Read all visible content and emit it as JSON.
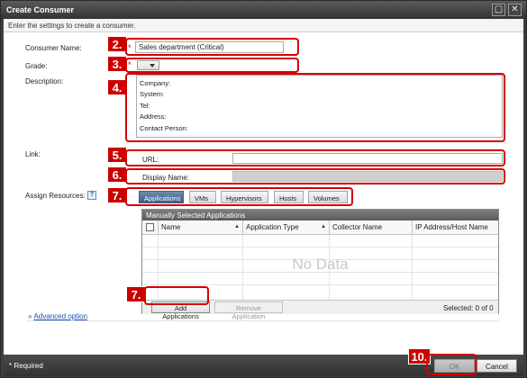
{
  "window": {
    "title": "Create Consumer",
    "maximize_icon": "maximize-icon",
    "close_icon": "close-icon"
  },
  "instructions": "Enter the settings to create a consumer.",
  "form": {
    "consumer_name": {
      "label": "Consumer Name:",
      "value": "Sales department (Critical)",
      "required": "*"
    },
    "grade": {
      "label": "Grade:",
      "required": "*",
      "value": ""
    },
    "description": {
      "label": "Description:",
      "lines": [
        "Company:",
        "System:",
        "Tel:",
        "Address:",
        "Contact Person:"
      ]
    },
    "link": {
      "label": "Link:",
      "url_label": "URL:",
      "url_value": "",
      "display_name_label": "Display Name:",
      "display_name_value": ""
    },
    "assign_resources": {
      "label": "Assign Resources:",
      "help_icon": "?",
      "tabs": [
        "Applications",
        "VMs",
        "Hypervisors",
        "Hosts",
        "Volumes"
      ],
      "active_tab": "Applications",
      "panel_title": "Manually Selected Applications",
      "columns": [
        "Name",
        "Application Type",
        "Collector Name",
        "IP Address/Host Name"
      ],
      "sort_marker": "▲",
      "empty_text": "No Data",
      "add_button": "Add Applications",
      "remove_button": "Remove Application",
      "selected_text": "Selected: 0 of 0"
    },
    "advanced_option": {
      "icon": "»",
      "label": "Advanced option"
    }
  },
  "callouts": {
    "c2": "2.",
    "c3": "3.",
    "c4": "4.",
    "c5": "5.",
    "c6": "6.",
    "c7a": "7.",
    "c7b": "7.",
    "c10": "10."
  },
  "footer": {
    "required_note": "* Required",
    "ok_label": "OK",
    "cancel_label": "Cancel"
  },
  "colors": {
    "callout": "#cc0000",
    "tab_active": "#3e5f88",
    "link": "#1a4fb0"
  }
}
